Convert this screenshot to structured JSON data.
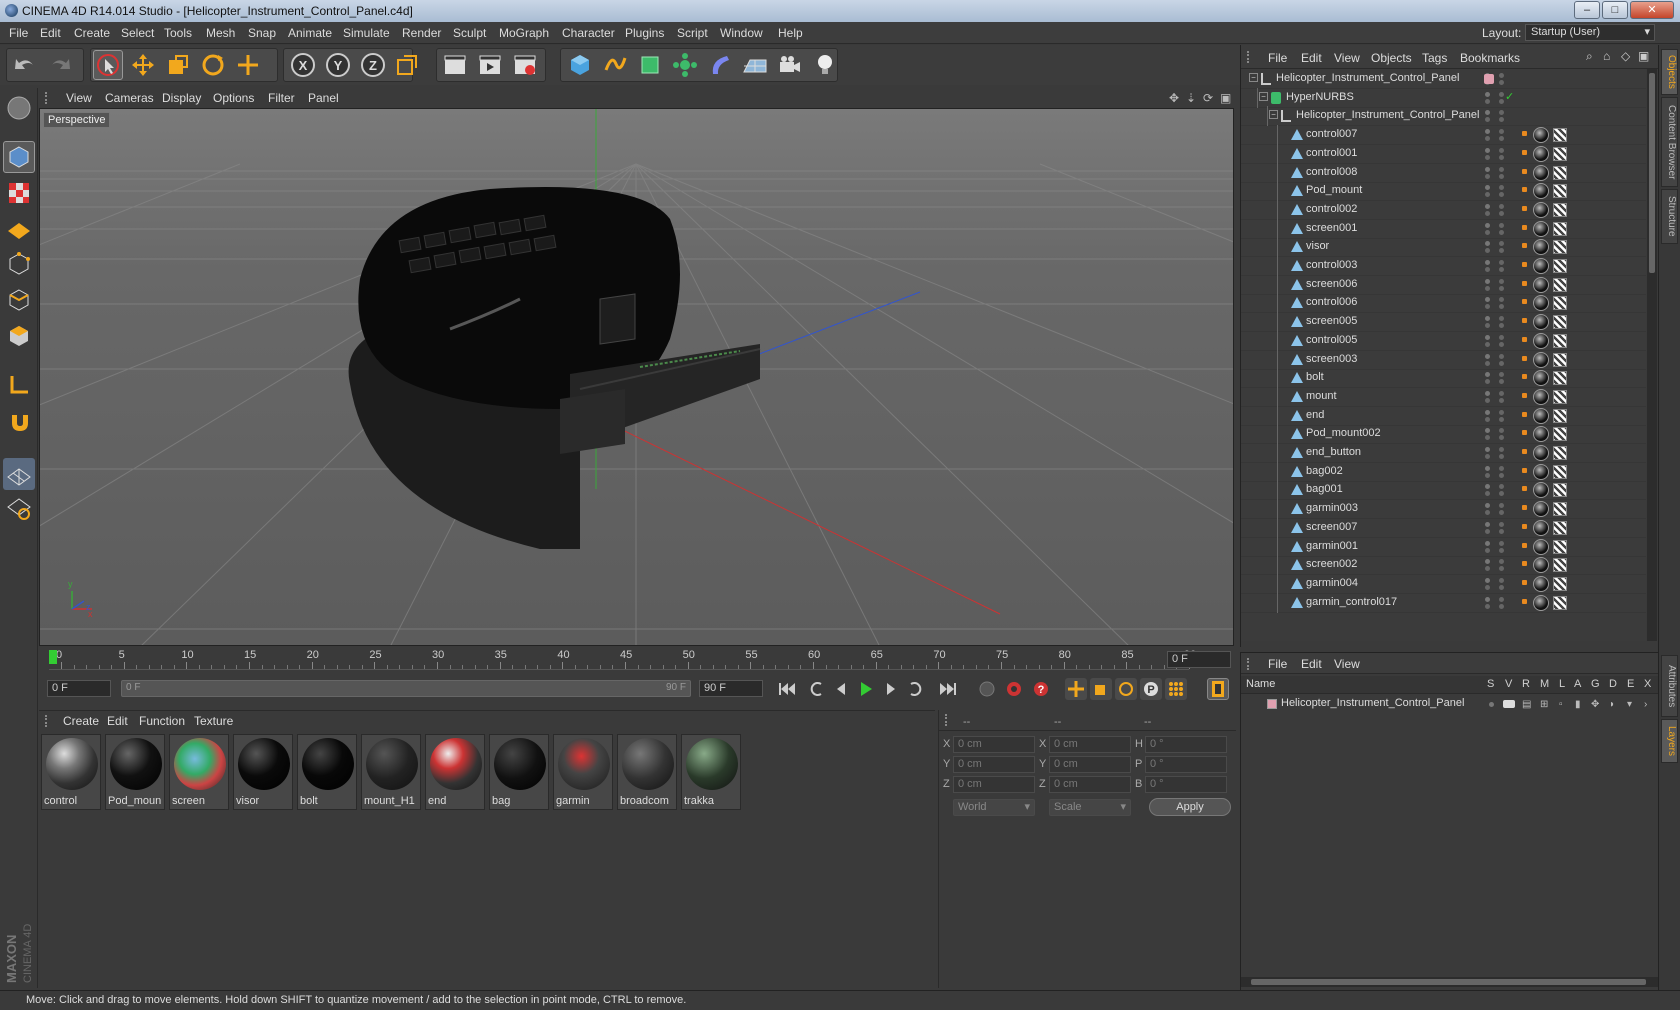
{
  "window": {
    "title": "CINEMA 4D R14.014 Studio - [Helicopter_Instrument_Control_Panel.c4d]"
  },
  "menubar": {
    "items": [
      "File",
      "Edit",
      "Create",
      "Select",
      "Tools",
      "Mesh",
      "Snap",
      "Animate",
      "Simulate",
      "Render",
      "Sculpt",
      "MoGraph",
      "Character",
      "Plugins",
      "Script",
      "Window",
      "Help"
    ],
    "layout_label": "Layout:",
    "layout_value": "Startup (User)"
  },
  "viewport": {
    "menu": [
      "View",
      "Cameras",
      "Display",
      "Options",
      "Filter",
      "Panel"
    ],
    "label": "Perspective",
    "axis_x": "x",
    "axis_y": "y",
    "axis_z": "z"
  },
  "timeline": {
    "ticks": [
      "0",
      "5",
      "10",
      "15",
      "20",
      "25",
      "30",
      "35",
      "40",
      "45",
      "50",
      "55",
      "60",
      "65",
      "70",
      "75",
      "80",
      "85",
      "90"
    ],
    "current_frame": "0 F"
  },
  "transport": {
    "start": "0 F",
    "range_start": "0 F",
    "range_end": "90 F",
    "end": "90 F"
  },
  "materials": {
    "menu": [
      "Create",
      "Edit",
      "Function",
      "Texture"
    ],
    "items": [
      {
        "name": "control"
      },
      {
        "name": "Pod_moun"
      },
      {
        "name": "screen"
      },
      {
        "name": "visor"
      },
      {
        "name": "bolt"
      },
      {
        "name": "mount_H1"
      },
      {
        "name": "end"
      },
      {
        "name": "bag"
      },
      {
        "name": "garmin"
      },
      {
        "name": "broadcom"
      },
      {
        "name": "trakka"
      }
    ]
  },
  "attributes": {
    "header": [
      "--",
      "--",
      "--"
    ],
    "rows": [
      {
        "l1": "X",
        "v1": "0 cm",
        "l2": "X",
        "v2": "0 cm",
        "l3": "H",
        "v3": "0 °"
      },
      {
        "l1": "Y",
        "v1": "0 cm",
        "l2": "Y",
        "v2": "0 cm",
        "l3": "P",
        "v3": "0 °"
      },
      {
        "l1": "Z",
        "v1": "0 cm",
        "l2": "Z",
        "v2": "0 cm",
        "l3": "B",
        "v3": "0 °"
      }
    ],
    "coord_mode": "World",
    "scale_mode": "Scale",
    "apply": "Apply"
  },
  "objects": {
    "menu": [
      "File",
      "Edit",
      "View",
      "Objects",
      "Tags",
      "Bookmarks"
    ],
    "tree": [
      {
        "name": "Helicopter_Instrument_Control_Panel",
        "indent": 0,
        "type": "null"
      },
      {
        "name": "HyperNURBS",
        "indent": 1,
        "type": "nurbs"
      },
      {
        "name": "Helicopter_Instrument_Control_Panel",
        "indent": 2,
        "type": "null"
      },
      {
        "name": "control007",
        "indent": 3,
        "type": "poly"
      },
      {
        "name": "control001",
        "indent": 3,
        "type": "poly"
      },
      {
        "name": "control008",
        "indent": 3,
        "type": "poly"
      },
      {
        "name": "Pod_mount",
        "indent": 3,
        "type": "poly"
      },
      {
        "name": "control002",
        "indent": 3,
        "type": "poly"
      },
      {
        "name": "screen001",
        "indent": 3,
        "type": "poly"
      },
      {
        "name": "visor",
        "indent": 3,
        "type": "poly"
      },
      {
        "name": "control003",
        "indent": 3,
        "type": "poly"
      },
      {
        "name": "screen006",
        "indent": 3,
        "type": "poly"
      },
      {
        "name": "control006",
        "indent": 3,
        "type": "poly"
      },
      {
        "name": "screen005",
        "indent": 3,
        "type": "poly"
      },
      {
        "name": "control005",
        "indent": 3,
        "type": "poly"
      },
      {
        "name": "screen003",
        "indent": 3,
        "type": "poly"
      },
      {
        "name": "bolt",
        "indent": 3,
        "type": "poly"
      },
      {
        "name": "mount",
        "indent": 3,
        "type": "poly"
      },
      {
        "name": "end",
        "indent": 3,
        "type": "poly"
      },
      {
        "name": "Pod_mount002",
        "indent": 3,
        "type": "poly"
      },
      {
        "name": "end_button",
        "indent": 3,
        "type": "poly"
      },
      {
        "name": "bag002",
        "indent": 3,
        "type": "poly"
      },
      {
        "name": "bag001",
        "indent": 3,
        "type": "poly"
      },
      {
        "name": "garmin003",
        "indent": 3,
        "type": "poly"
      },
      {
        "name": "screen007",
        "indent": 3,
        "type": "poly"
      },
      {
        "name": "garmin001",
        "indent": 3,
        "type": "poly"
      },
      {
        "name": "screen002",
        "indent": 3,
        "type": "poly"
      },
      {
        "name": "garmin004",
        "indent": 3,
        "type": "poly"
      },
      {
        "name": "garmin_control017",
        "indent": 3,
        "type": "poly"
      }
    ]
  },
  "layers": {
    "menu": [
      "File",
      "Edit",
      "View"
    ],
    "columns": {
      "name": "Name",
      "flags": [
        "S",
        "V",
        "R",
        "M",
        "L",
        "A",
        "G",
        "D",
        "E",
        "X"
      ]
    },
    "rows": [
      {
        "name": "Helicopter_Instrument_Control_Panel"
      }
    ]
  },
  "side_tabs": [
    "Objects",
    "Content Browser",
    "Structure",
    "Attributes",
    "Layers"
  ],
  "status": "Move: Click and drag to move elements. Hold down SHIFT to quantize movement / add to the selection in point mode, CTRL to remove.",
  "brand": {
    "line1": "MAXON",
    "line2": "CINEMA 4D"
  }
}
